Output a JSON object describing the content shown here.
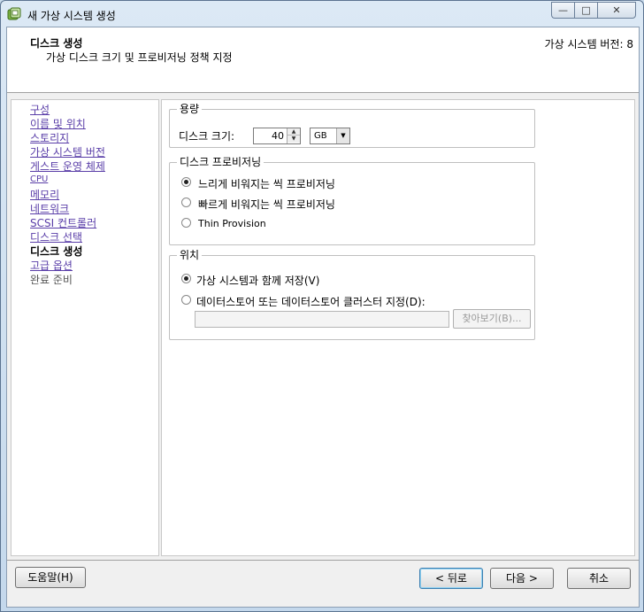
{
  "window": {
    "title": "새 가상 시스템 생성",
    "controls": {
      "minimize": "—",
      "maximize": "□",
      "close": "✕"
    }
  },
  "header": {
    "title": "디스크 생성",
    "subtitle": "가상 디스크 크기 및 프로비저닝 정책 지정",
    "version": "가상 시스템 버전: 8"
  },
  "nav": {
    "items": [
      {
        "label": "구성"
      },
      {
        "label": "이름 및 위치"
      },
      {
        "label": "스토리지"
      },
      {
        "label": "가상 시스템 버전"
      },
      {
        "label": "게스트 운영 체제"
      },
      {
        "label": "CPU"
      },
      {
        "label": "메모리"
      },
      {
        "label": "네트워크"
      },
      {
        "label": "SCSI 컨트롤러"
      },
      {
        "label": "디스크 선택"
      },
      {
        "label": "디스크 생성"
      },
      {
        "label": "고급 옵션"
      },
      {
        "label": "완료 준비"
      }
    ]
  },
  "capacity": {
    "legend": "용량",
    "disk_size_label": "디스크 크기:",
    "disk_size_value": "40",
    "unit": "GB"
  },
  "provisioning": {
    "legend": "디스크 프로비저닝",
    "options": [
      {
        "label": "느리게 비워지는 씩 프로비저닝",
        "selected": true
      },
      {
        "label": "빠르게 비워지는 씩 프로비저닝",
        "selected": false
      },
      {
        "label": "Thin Provision",
        "selected": false
      }
    ]
  },
  "location": {
    "legend": "위치",
    "options": [
      {
        "label": "가상 시스템과 함께 저장(V)",
        "selected": true
      },
      {
        "label": "데이터스토어 또는 데이터스토어 클러스터 지정(D):",
        "selected": false
      }
    ],
    "path_value": "",
    "browse_label": "찾아보기(B)..."
  },
  "footer": {
    "help_label": "도움말(H)",
    "back_label": "< 뒤로",
    "next_label": "다음 >",
    "cancel_label": "취소"
  }
}
